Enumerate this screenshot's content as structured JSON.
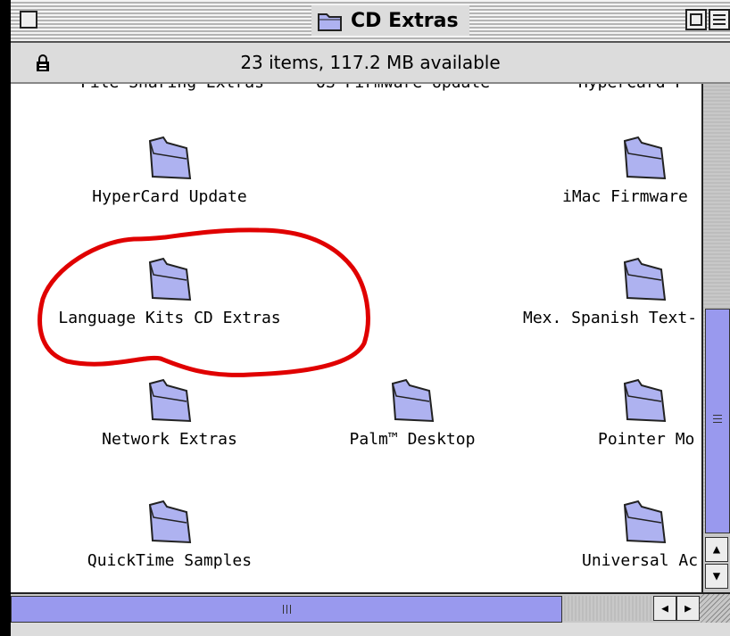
{
  "window": {
    "title": "CD Extras",
    "info": "23 items, 117.2 MB available"
  },
  "cut_row": [
    "File Sharing Extras",
    "OS Firmware Update",
    "HyperCard P"
  ],
  "items": [
    {
      "label": "HyperCard Update"
    },
    {
      "label": "iMac Firmware"
    },
    {
      "label": "Language Kits CD Extras"
    },
    {
      "label": "Mex. Spanish Text-"
    },
    {
      "label": "Network Extras"
    },
    {
      "label": "Palm™ Desktop"
    },
    {
      "label": "Pointer Mo"
    },
    {
      "label": "QuickTime Samples"
    },
    {
      "label": "Universal Ac"
    }
  ],
  "scroll": {
    "vertical_position": 0.48,
    "horizontal_visible_fraction": 0.78
  },
  "colors": {
    "folder_fill": "#aeb2f0",
    "scroll_thumb": "#9999ee",
    "annotation": "#e00000"
  }
}
